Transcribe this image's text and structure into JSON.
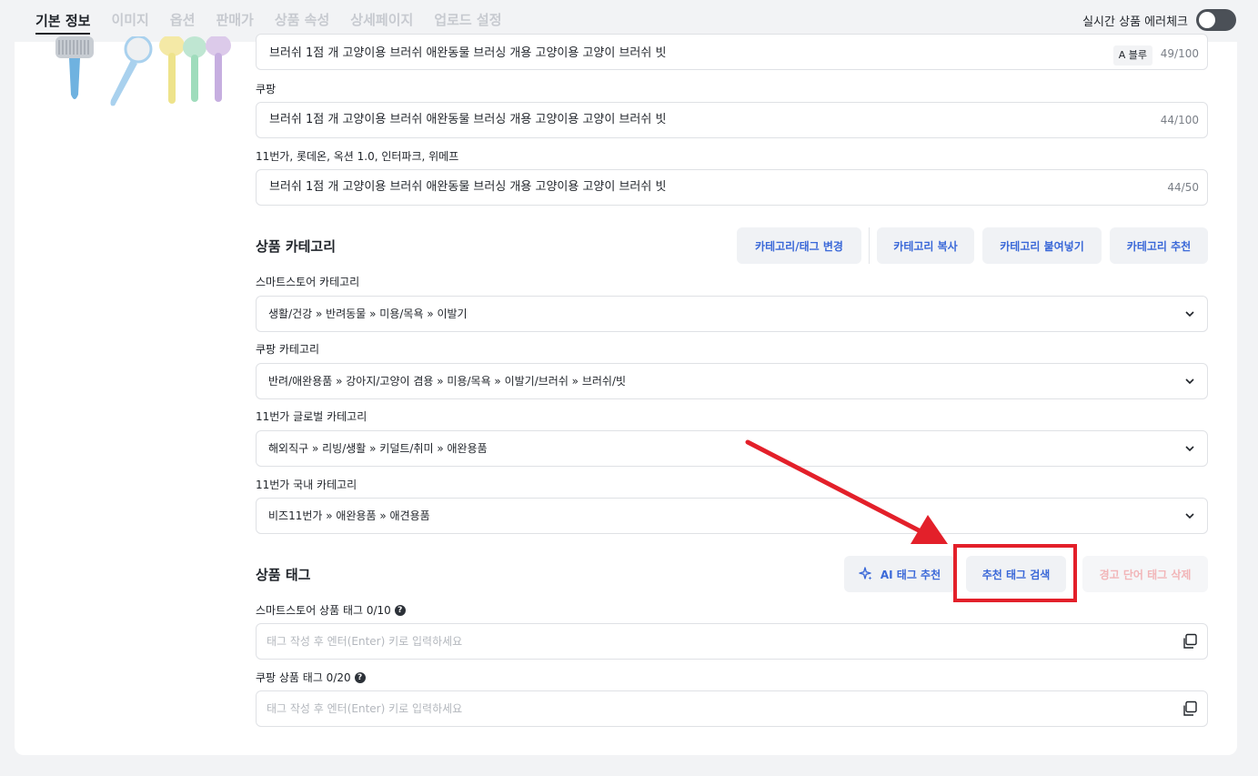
{
  "nav": {
    "tabs": [
      {
        "label": "기본 정보",
        "active": true
      },
      {
        "label": "이미지"
      },
      {
        "label": "옵션"
      },
      {
        "label": "판매가"
      },
      {
        "label": "상품 속성"
      },
      {
        "label": "상세페이지"
      },
      {
        "label": "업로드 설정"
      }
    ],
    "toggle_label": "실시간 상품 에러체크"
  },
  "names": {
    "smartstore": {
      "value": "브러쉬 1점 개 고양이용 브러쉬 애완동물 브러싱 개용 고양이용 고양이 브러쉬 빗",
      "font_badge": "A 블루",
      "counter": "49/100"
    },
    "coupang": {
      "label": "쿠팡",
      "value": "브러쉬 1점 개 고양이용 브러쉬 애완동물 브러싱 개용 고양이용 고양이 브러쉬 빗",
      "counter": "44/100"
    },
    "others": {
      "label": "11번가, 롯데온, 옥션 1.0, 인터파크, 위메프",
      "value": "브러쉬 1점 개 고양이용 브러쉬 애완동물 브러싱 개용 고양이용 고양이 브러쉬 빗",
      "counter": "44/50"
    }
  },
  "category": {
    "title": "상품 카테고리",
    "buttons": {
      "change": "카테고리/태그 변경",
      "copy": "카테고리 복사",
      "paste": "카테고리 붙여넣기",
      "recommend": "카테고리 추천"
    },
    "smartstore": {
      "label": "스마트스토어 카테고리",
      "value": "생활/건강 » 반려동물 » 미용/목욕 » 이발기"
    },
    "coupang": {
      "label": "쿠팡 카테고리",
      "value": "반려/애완용품 » 강아지/고양이 겸용 » 미용/목욕 » 이발기/브러쉬 » 브러쉬/빗"
    },
    "st11_global": {
      "label": "11번가 글로벌 카테고리",
      "value": "해외직구 » 리빙/생활 » 키덜트/취미 » 애완용품"
    },
    "st11_domestic": {
      "label": "11번가 국내 카테고리",
      "value": "비즈11번가 » 애완용품 » 애견용품"
    }
  },
  "tags": {
    "title": "상품 태그",
    "buttons": {
      "ai": "AI 태그 추천",
      "search": "추천 태그 검색",
      "delete_warning": "경고 단어 태그 삭제"
    },
    "smartstore": {
      "label": "스마트스토어 상품 태그 0/10",
      "placeholder": "태그 작성 후 엔터(Enter) 키로 입력하세요"
    },
    "coupang": {
      "label": "쿠팡 상품 태그 0/20",
      "placeholder": "태그 작성 후 엔터(Enter) 키로 입력하세요"
    },
    "help_glyph": "?"
  },
  "colors": {
    "accent_blue": "#3a68d8",
    "annotation_red": "#e3202a",
    "disabled_red": "#f2b5b8"
  }
}
